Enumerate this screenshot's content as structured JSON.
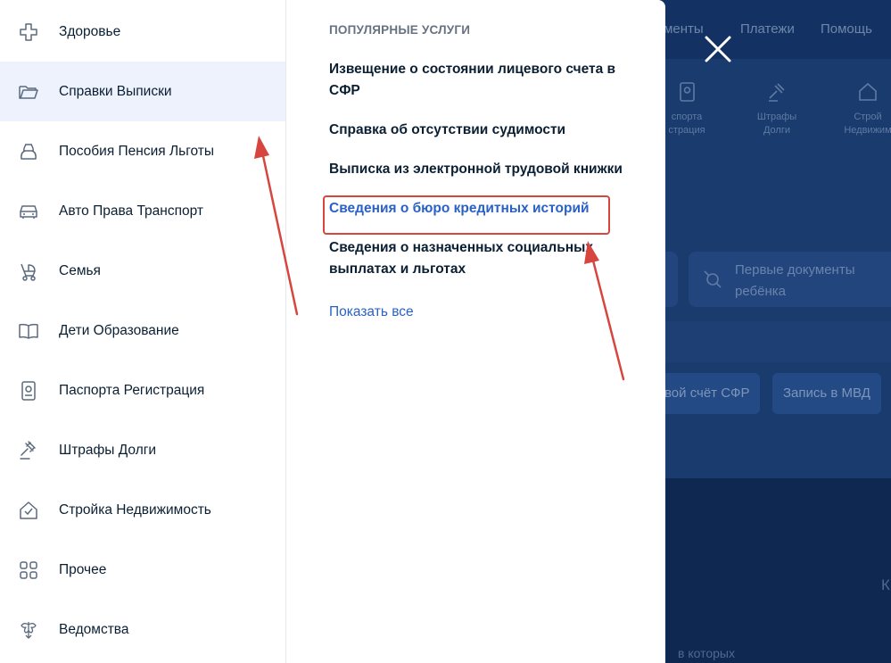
{
  "background": {
    "nav": [
      "кументы",
      "Платежи",
      "Помощь"
    ],
    "categories": [
      {
        "line1": "спорта",
        "line2": "страция"
      },
      {
        "line1": "Штрафы",
        "line2": "Долги"
      },
      {
        "line1": "Строй",
        "line2": "Недвижим"
      }
    ],
    "card_text_line1": "Первые документы",
    "card_text_line2": "ребёнка",
    "chips": [
      "вой счёт СФР",
      "Запись в МВД"
    ],
    "bottom_text": "в которых",
    "bottom_letter": "К"
  },
  "sidebar": {
    "items": [
      {
        "label": "Здоровье",
        "icon": "health-cross-icon"
      },
      {
        "label": "Справки Выписки",
        "icon": "folder-icon"
      },
      {
        "label": "Пособия Пенсия Льготы",
        "icon": "wallet-icon"
      },
      {
        "label": "Авто Права Транспорт",
        "icon": "car-icon"
      },
      {
        "label": "Семья",
        "icon": "stroller-icon"
      },
      {
        "label": "Дети Образование",
        "icon": "book-icon"
      },
      {
        "label": "Паспорта Регистрация",
        "icon": "passport-icon"
      },
      {
        "label": "Штрафы Долги",
        "icon": "gavel-icon"
      },
      {
        "label": "Стройка Недвижимость",
        "icon": "house-icon"
      },
      {
        "label": "Прочее",
        "icon": "grid-icon"
      },
      {
        "label": "Ведомства",
        "icon": "coat-of-arms-icon"
      }
    ],
    "active_index": 1
  },
  "content": {
    "section_title": "ПОПУЛЯРНЫЕ УСЛУГИ",
    "services": [
      {
        "label": "Извещение о состоянии лицевого счета в СФР",
        "highlighted": false
      },
      {
        "label": "Справка об отсутствии судимости",
        "highlighted": false
      },
      {
        "label": "Выписка из электронной трудовой книжки",
        "highlighted": false
      },
      {
        "label": "Сведения о бюро кредитных историй",
        "highlighted": true
      },
      {
        "label": "Сведения о назначенных социальных выплатах и льготах",
        "highlighted": false
      }
    ],
    "show_all": "Показать все"
  },
  "colors": {
    "link": "#2a61c7",
    "text": "#0b1f33",
    "active_bg": "#edf2fd",
    "annotation": "#d6463f"
  }
}
